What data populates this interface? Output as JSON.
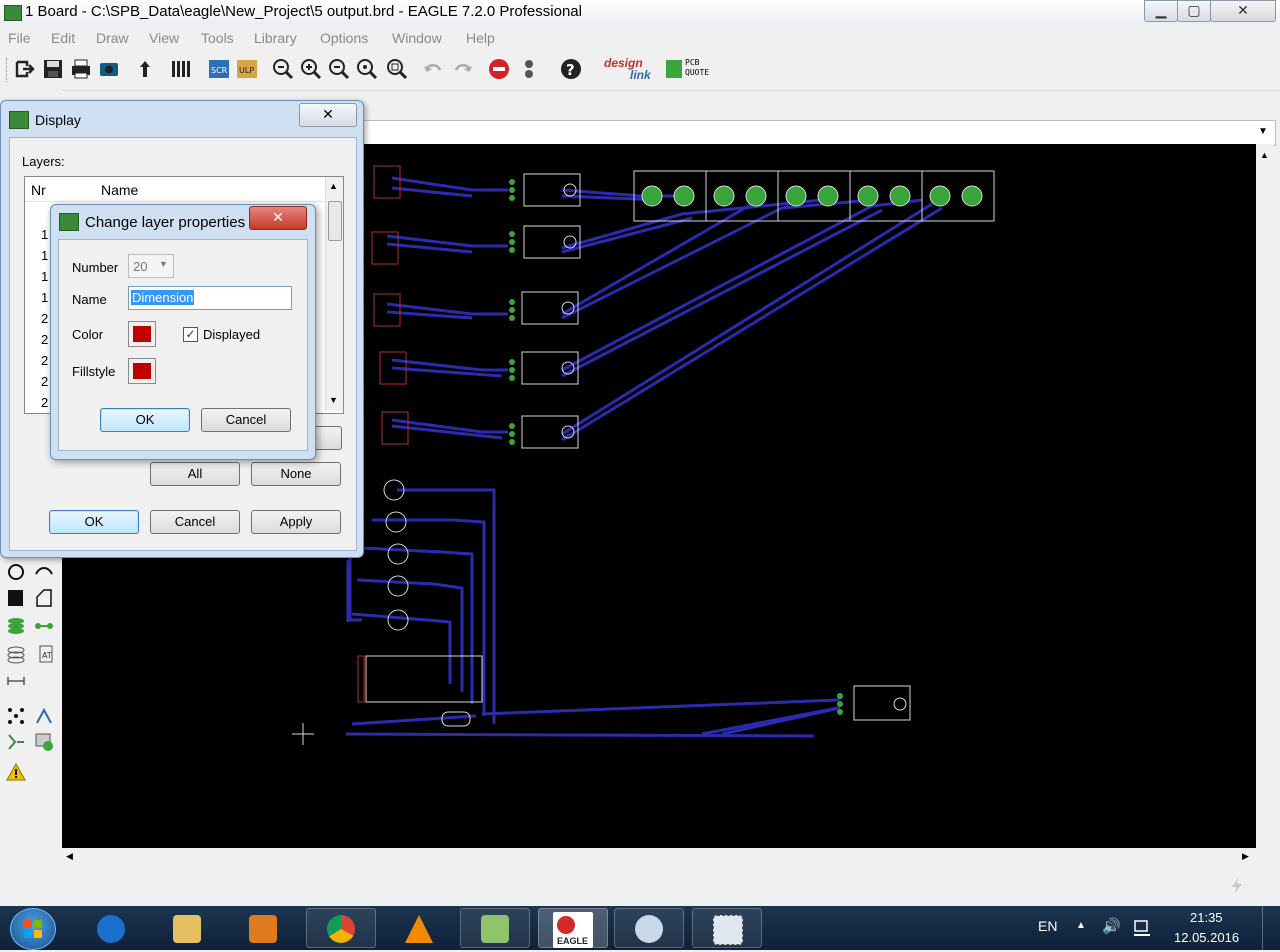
{
  "window": {
    "title": "1 Board - C:\\SPB_Data\\eagle\\New_Project\\5 output.brd - EAGLE 7.2.0 Professional",
    "controls": {
      "minimize": "▁",
      "maximize": "▢",
      "close": "✕"
    }
  },
  "menu": [
    "File",
    "Edit",
    "Draw",
    "View",
    "Tools",
    "Library",
    "Options",
    "Window",
    "Help"
  ],
  "toolbar": {
    "icons": [
      "open-icon",
      "save-icon",
      "print-icon",
      "cam-icon",
      "upload-icon",
      "layers-icon",
      "script-icon",
      "ulp-icon",
      "zoom-fit-icon",
      "zoom-in-icon",
      "zoom-out-icon",
      "zoom-select-icon",
      "zoom-area-icon",
      "undo-icon",
      "redo-icon",
      "stop-icon",
      "go-icon",
      "help-icon"
    ],
    "brand1": [
      "design",
      "link"
    ],
    "brand2": [
      "PCB",
      "QUOTE"
    ]
  },
  "display_dialog": {
    "title": "Display",
    "layers_label": "Layers:",
    "columns": [
      "Nr",
      "Name"
    ],
    "row_numbers": [
      "1",
      "1",
      "1",
      "1",
      "2",
      "2",
      "2",
      "2",
      "2"
    ],
    "buttons": {
      "all": "All",
      "none": "None",
      "ok": "OK",
      "cancel": "Cancel",
      "apply": "Apply"
    }
  },
  "layer_dialog": {
    "title": "Change layer properties",
    "number_label": "Number",
    "number_value": "20",
    "name_label": "Name",
    "name_value": "Dimension",
    "color_label": "Color",
    "color_value": "#c00000",
    "displayed_label": "Displayed",
    "displayed_checked": true,
    "fillstyle_label": "Fillstyle",
    "fill_value": "#c00000",
    "ok": "OK",
    "cancel": "Cancel"
  },
  "colors": {
    "canvas": "#000000",
    "wire": "#2b2bb0",
    "pad": "#3aa53a",
    "outline": "#d8d8d8",
    "part_red": "#b03030"
  },
  "taskbar": {
    "lang": "EN",
    "time": "21:35",
    "date": "12.05.2016",
    "apps": [
      "start-orb",
      "internet-explorer",
      "file-explorer",
      "media-player",
      "chrome",
      "vlc",
      "unknown-app",
      "eagle",
      "paint",
      "screenshot-tool"
    ],
    "eagle_label": "EAGLE"
  }
}
